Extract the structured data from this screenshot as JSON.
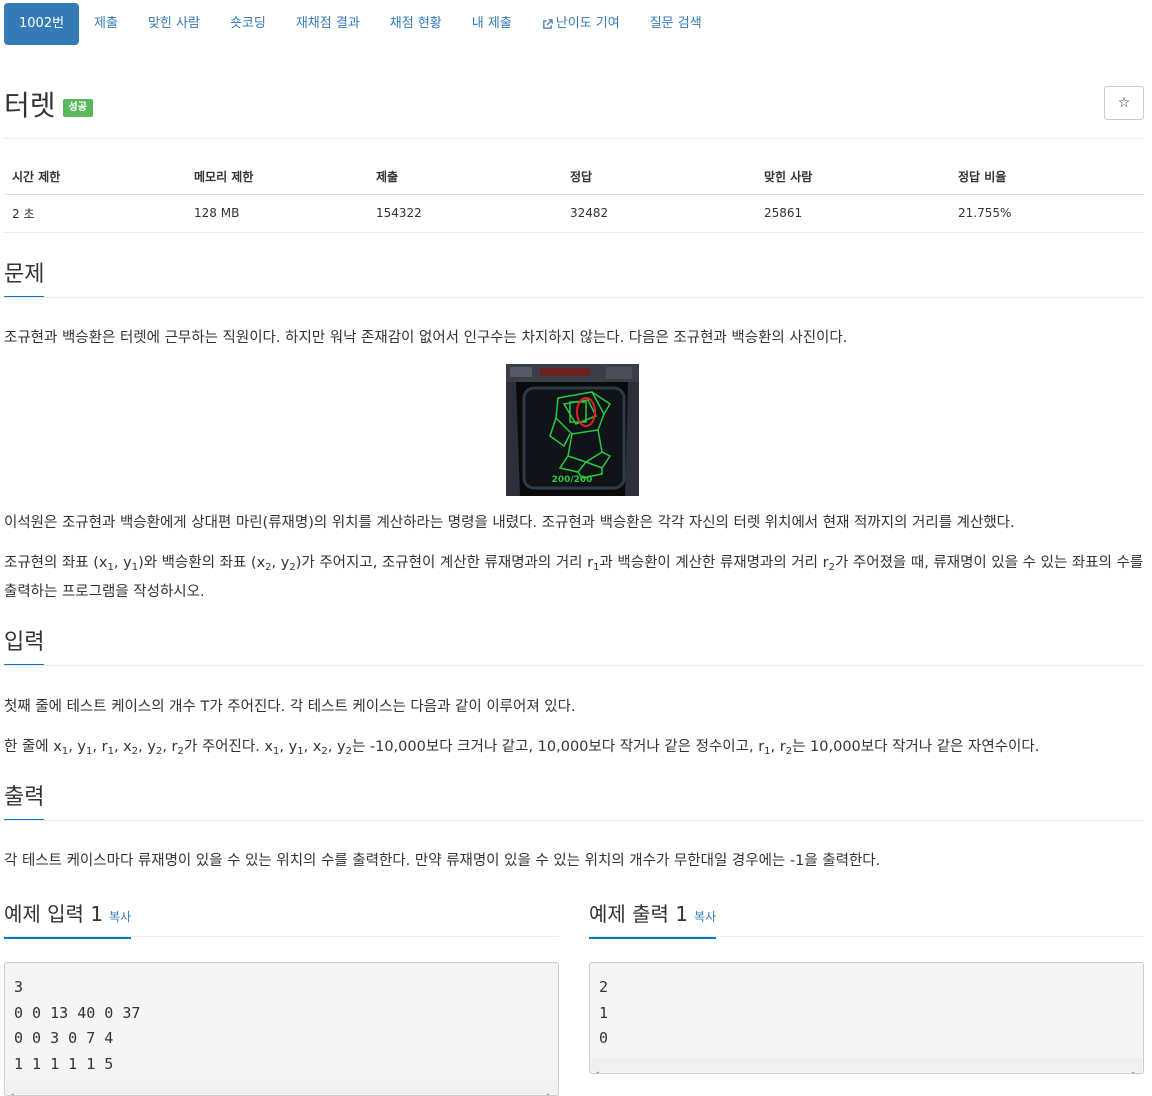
{
  "nav": {
    "items": [
      {
        "label": "1002번",
        "active": true
      },
      {
        "label": "제출"
      },
      {
        "label": "맞힌 사람"
      },
      {
        "label": "숏코딩"
      },
      {
        "label": "재채점 결과"
      },
      {
        "label": "채점 현황"
      },
      {
        "label": "내 제출"
      },
      {
        "label": "난이도 기여",
        "icon": "external-link-icon"
      },
      {
        "label": "질문 검색"
      }
    ]
  },
  "problem": {
    "title": "터렛",
    "status_badge": "성공",
    "star_icon": "☆"
  },
  "info": {
    "headers": [
      "시간 제한",
      "메모리 제한",
      "제출",
      "정답",
      "맞힌 사람",
      "정답 비율"
    ],
    "values": [
      "2 초",
      "128 MB",
      "154322",
      "32482",
      "25861",
      "21.755%"
    ]
  },
  "sections": {
    "problem_heading": "문제",
    "problem_p1": "조규현과 백승환은 터렛에 근무하는 직원이다. 하지만 워낙 존재감이 없어서 인구수는 차지하지 않는다. 다음은 조규현과 백승환의 사진이다.",
    "image_caption": "200/200",
    "problem_p2": "이석원은 조규현과 백승환에게 상대편 마린(류재명)의 위치를 계산하라는 명령을 내렸다. 조규현과 백승환은 각각 자신의 터렛 위치에서 현재 적까지의 거리를 계산했다.",
    "problem_p3": {
      "a": "조규현의 좌표 (x",
      "b": ", y",
      "c": ")와 백승환의 좌표 (x",
      "d": ", y",
      "e": ")가 주어지고, 조규현이 계산한 류재명과의 거리 r",
      "f": "과 백승환이 계산한 류재명과의 거리 r",
      "g": "가 주어졌을 때, 류재명이 있을 수 있는 좌표의 수를 출력하는 프로그램을 작성하시오.",
      "sub1": "1",
      "sub2": "2"
    },
    "input_heading": "입력",
    "input_p1": "첫째 줄에 테스트 케이스의 개수 T가 주어진다. 각 테스트 케이스는 다음과 같이 이루어져 있다.",
    "input_p2": {
      "a": "한 줄에 x",
      "b": ", y",
      "c": ", r",
      "d": ", x",
      "e": ", y",
      "f": ", r",
      "g": "가 주어진다. x",
      "h": ", y",
      "i": ", x",
      "j": ", y",
      "k": "는 -10,000보다 크거나 같고, 10,000보다 작거나 같은 정수이고, r",
      "l": ", r",
      "m": "는 10,000보다 작거나 같은 자연수이다.",
      "sub1": "1",
      "sub2": "2"
    },
    "output_heading": "출력",
    "output_p1": "각 테스트 케이스마다 류재명이 있을 수 있는 위치의 수를 출력한다. 만약 류재명이 있을 수 있는 위치의 개수가 무한대일 경우에는 -1을 출력한다."
  },
  "samples": {
    "input_heading": "예제 입력 1",
    "output_heading": "예제 출력 1",
    "copy_label": "복사",
    "input_lines": [
      "3",
      "0 0 13 40 0 37",
      "0 0 3 0 7 4",
      "1 1 1 1 1 5"
    ],
    "output_lines": [
      "2",
      "1",
      "0"
    ]
  },
  "colors": {
    "accent": "#337ab7",
    "success": "#5cb85c",
    "section_underline": "#0076c0"
  }
}
